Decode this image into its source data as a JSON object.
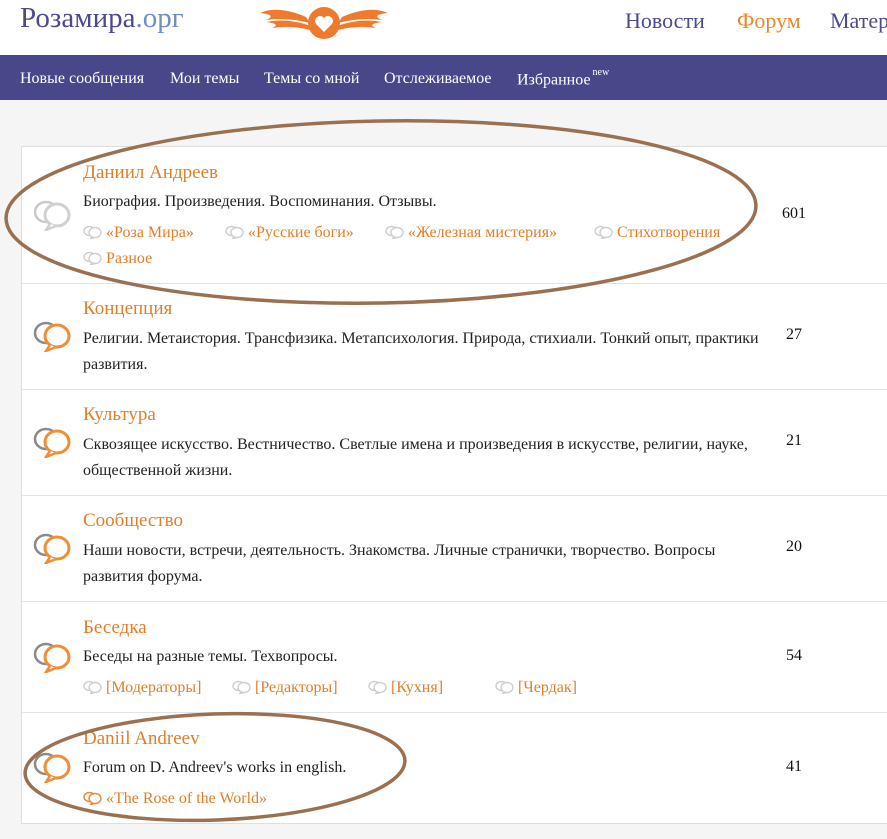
{
  "site": {
    "name_main": "Розамира",
    "name_domain": ".орг"
  },
  "top_nav": [
    "Новости",
    "Форум",
    "Матер"
  ],
  "sub_nav": {
    "items": [
      "Новые сообщения",
      "Мои темы",
      "Темы со мной",
      "Отслеживаемое",
      "Избранное"
    ],
    "new_badge": "new"
  },
  "forums": [
    {
      "title": "Даниил Андреев",
      "description": "Биография. Произведения. Воспоминания. Отзывы.",
      "count": "601",
      "subforums": [
        "«Роза Мира»",
        "«Русские боги»",
        "«Железная мистерия»",
        "Стихотворения",
        "Разное"
      ]
    },
    {
      "title": "Концепция",
      "description": "Религии. Метаистория. Трансфизика. Метапсихология. Природа, стихиали. Тонкий опыт, практики развития.",
      "count": "27",
      "subforums": []
    },
    {
      "title": "Культура",
      "description": "Сквозящее искусство. Вестничество. Светлые имена и произведения в искусстве, религии, науке, общественной жизни.",
      "count": "21",
      "subforums": []
    },
    {
      "title": "Сообщество",
      "description": "Наши новости, встречи, деятельность. Знакомства. Личные странички, творчество. Вопросы развития форума.",
      "count": "20",
      "subforums": []
    },
    {
      "title": "Беседка",
      "description": "Беседы на разные темы. Техвопросы.",
      "count": "54",
      "subforums": [
        "[Модераторы]",
        "[Редакторы]",
        "[Кухня]",
        "[Чердак]"
      ]
    },
    {
      "title": "Daniil Andreev",
      "description": "Forum on D. Andreev's works in english.",
      "count": "41",
      "subforums": [
        "«The Rose of the World»"
      ]
    }
  ],
  "colors": {
    "brand": "#4a4a8f",
    "accent": "#e07f28",
    "subnav_bg": "#47478a",
    "annotation": "#9a7050"
  },
  "icons": {
    "forum_unread": "speech-bubbles-icon",
    "forum_read": "speech-bubbles-grey-icon",
    "subforum": "small-speech-bubbles-icon",
    "emblem": "winged-heart-icon"
  }
}
